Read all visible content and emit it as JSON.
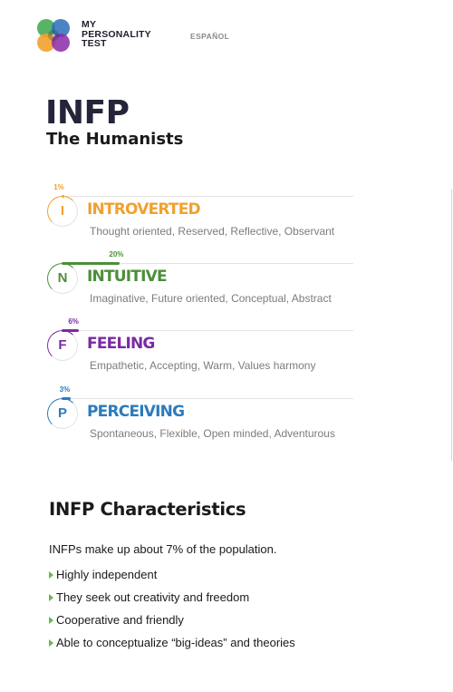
{
  "header": {
    "brand_line1": "MY",
    "brand_line2": "PERSONALITY",
    "brand_line3": "TEST",
    "language_link": "ESPAÑOL"
  },
  "result": {
    "type_code": "INFP",
    "type_name": "The Humanists"
  },
  "traits": [
    {
      "letter": "I",
      "name": "INTROVERTED",
      "percent": "1%",
      "percent_value": 1,
      "description": "Thought oriented, Reserved, Reflective, Observant",
      "color": "#f0a130"
    },
    {
      "letter": "N",
      "name": "INTUITIVE",
      "percent": "20%",
      "percent_value": 20,
      "description": "Imaginative, Future oriented, Conceptual, Abstract",
      "color": "#4c8f3a"
    },
    {
      "letter": "F",
      "name": "FEELING",
      "percent": "6%",
      "percent_value": 6,
      "description": "Empathetic, Accepting, Warm, Values harmony",
      "color": "#7a2aa3"
    },
    {
      "letter": "P",
      "name": "PERCEIVING",
      "percent": "3%",
      "percent_value": 3,
      "description": "Spontaneous, Flexible, Open minded, Adventurous",
      "color": "#2c7bbd"
    }
  ],
  "characteristics": {
    "title": "INFP Characteristics",
    "intro": "INFPs make up about 7% of the population.",
    "bullets": [
      "Highly independent",
      "They seek out creativity and freedom",
      "Cooperative and friendly",
      "Able to conceptualize “big-ideas” and theories"
    ],
    "bullet_color": "#66b94a"
  }
}
